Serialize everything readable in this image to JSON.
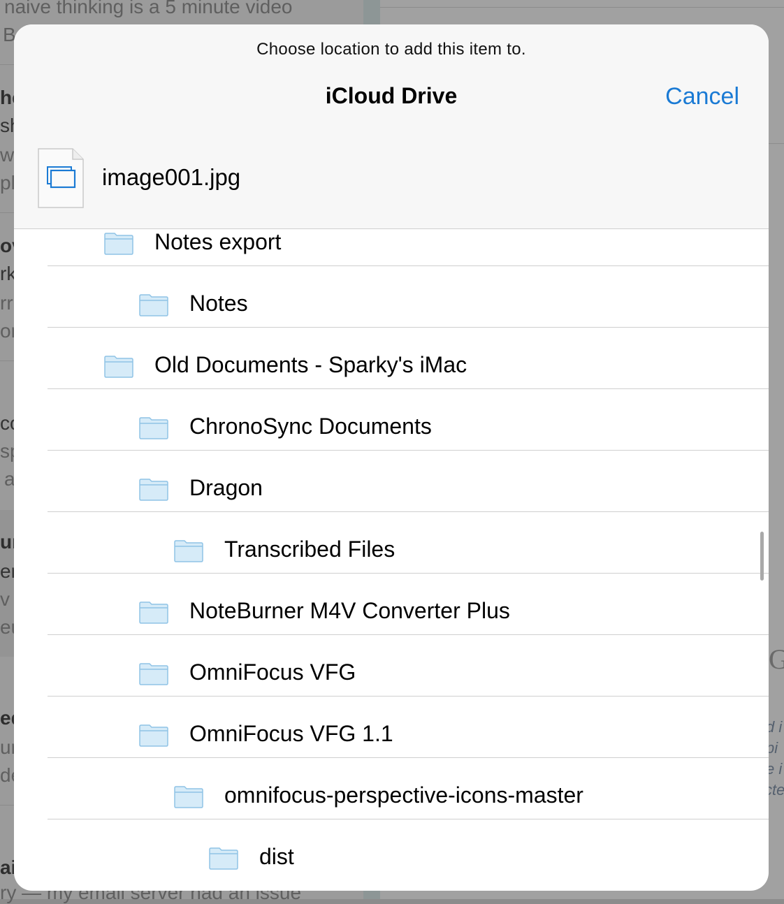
{
  "background": {
    "snippets": [
      "naive thinking is a 5 minute video",
      "B",
      "he",
      "sh",
      "w",
      "ple",
      "ov",
      "rk",
      "rr",
      "or",
      "co",
      "sp",
      "a",
      "ur",
      "er",
      "v a",
      "eu",
      "ed",
      "ur",
      "de",
      "ai",
      "ry — my email server had an issue"
    ],
    "right_snippets": [
      "G",
      "d i",
      "pi",
      "e i",
      "cte"
    ]
  },
  "sheet": {
    "prompt": "Choose location to add this item to.",
    "title": "iCloud Drive",
    "cancel_label": "Cancel",
    "file_name": "image001.jpg",
    "folders": [
      {
        "label": "Notes export",
        "level": 1
      },
      {
        "label": "Notes",
        "level": 2
      },
      {
        "label": "Old Documents - Sparky's iMac",
        "level": 1
      },
      {
        "label": "ChronoSync Documents",
        "level": 2
      },
      {
        "label": "Dragon",
        "level": 2
      },
      {
        "label": "Transcribed Files",
        "level": 3
      },
      {
        "label": "NoteBurner M4V Converter Plus",
        "level": 2
      },
      {
        "label": "OmniFocus VFG",
        "level": 2
      },
      {
        "label": "OmniFocus VFG 1.1",
        "level": 2
      },
      {
        "label": "omnifocus-perspective-icons-master",
        "level": 3
      },
      {
        "label": "dist",
        "level": 4
      }
    ]
  },
  "colors": {
    "accent": "#1a7ad4",
    "folder_fill": "#d6ebf8",
    "folder_stroke": "#8fc3e6"
  }
}
